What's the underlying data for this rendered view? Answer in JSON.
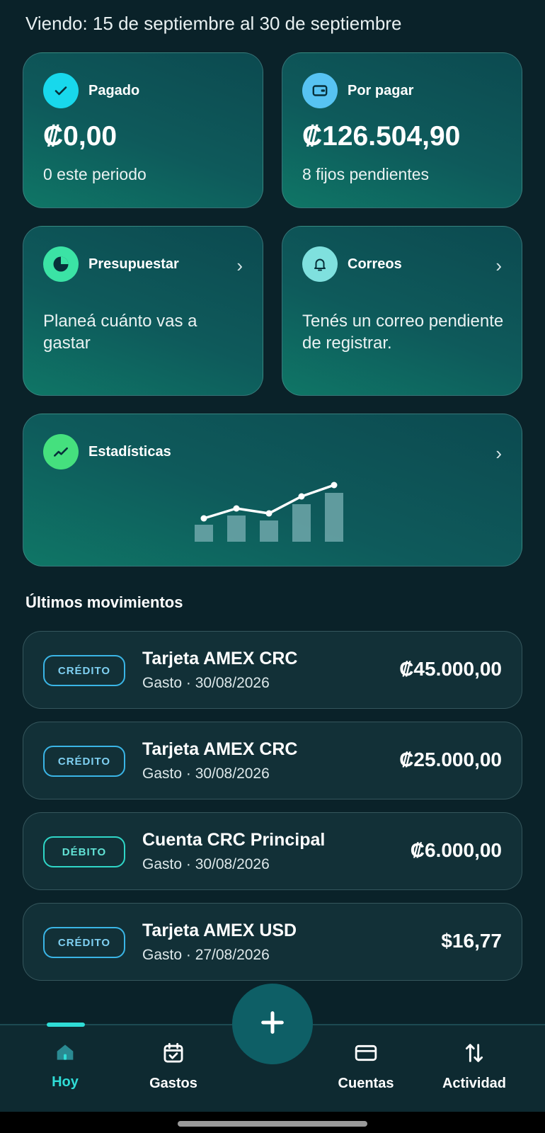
{
  "period_label": "Viendo: 15 de septiembre al 30 de septiembre",
  "cards": {
    "paid": {
      "title": "Pagado",
      "amount": "₡0,00",
      "sub": "0 este periodo",
      "icon": "check-icon",
      "icon_color": "#18d8ec"
    },
    "to_pay": {
      "title": "Por pagar",
      "amount": "₡126.504,90",
      "sub": "8 fijos pendientes",
      "icon": "wallet-icon",
      "icon_color": "#57c3f2"
    },
    "budget": {
      "title": "Presupuestar",
      "desc": "Planeá cuánto vas a gastar",
      "icon": "pie-chart-icon",
      "icon_color": "#3be3a5"
    },
    "emails": {
      "title": "Correos",
      "desc": "Tenés un correo pendiente de registrar.",
      "icon": "bell-icon",
      "icon_color": "#7fe0de"
    },
    "stats": {
      "title": "Estadísticas",
      "icon": "trend-icon",
      "icon_color": "#45e07e"
    }
  },
  "chevron": "›",
  "movements": {
    "title": "Últimos movimientos",
    "items": [
      {
        "badge": "CRÉDITO",
        "name": "Tarjeta AMEX CRC",
        "meta": "Gasto · 30/08/2026",
        "amount": "₡45.000,00"
      },
      {
        "badge": "CRÉDITO",
        "name": "Tarjeta AMEX CRC",
        "meta": "Gasto · 30/08/2026",
        "amount": "₡25.000,00"
      },
      {
        "badge": "DÉBITO",
        "name": "Cuenta CRC Principal",
        "meta": "Gasto · 30/08/2026",
        "amount": "₡6.000,00"
      },
      {
        "badge": "CRÉDITO",
        "name": "Tarjeta AMEX USD",
        "meta": "Gasto · 27/08/2026",
        "amount": "$16,77"
      }
    ]
  },
  "nav": {
    "today": "Hoy",
    "expenses": "Gastos",
    "accounts": "Cuentas",
    "activity": "Actividad"
  },
  "colors": {
    "accent": "#2fdcd6",
    "credit": "#3ab5e6",
    "debit": "#2fd6c7"
  }
}
